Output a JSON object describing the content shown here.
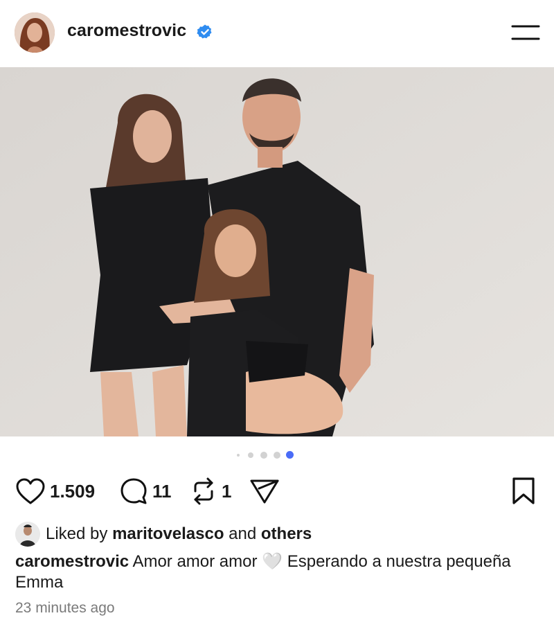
{
  "post": {
    "username": "caromestrovic",
    "verified": true,
    "image_description_alt": "",
    "carousel": {
      "count": 5,
      "active_index": 4,
      "active_color": "#4a6cf7"
    },
    "actions": {
      "likes": "1.509",
      "comments": "11",
      "reposts": "1"
    },
    "liked_by": {
      "prefix": "Liked by",
      "user": "maritovelasco",
      "and": "and",
      "others": "others"
    },
    "caption": {
      "username": "caromestrovic",
      "text_before_emoji": "Amor amor amor",
      "emoji": "🤍",
      "text_after_emoji": "Esperando a nuestra pequeña Emma"
    },
    "timestamp": "23 minutes ago"
  },
  "icons": {
    "verified": "verified-badge-icon",
    "menu": "menu-icon",
    "like": "heart-icon",
    "comment": "comment-icon",
    "repost": "repost-icon",
    "share": "send-icon",
    "save": "bookmark-icon"
  },
  "colors": {
    "verified": "#2f8cf0",
    "text": "#1a1a1a",
    "muted": "#7a7a7a"
  }
}
